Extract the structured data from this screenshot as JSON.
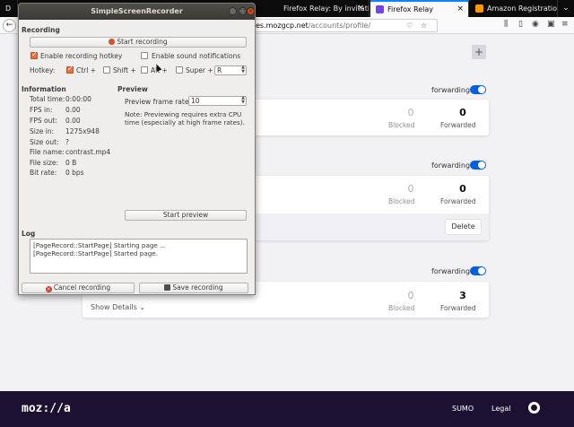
{
  "browser": {
    "tabs": [
      {
        "label": "D",
        "active": false
      },
      {
        "label": "Firefox Relay: By invitati",
        "active": false
      },
      {
        "label": "Firefox Relay",
        "active": true
      },
      {
        "label": "Amazon Registration",
        "active": false
      }
    ],
    "tab_close": "×",
    "back_label": "←",
    "url_host": "es.mozgcp.net",
    "url_path": "/accounts/profile/"
  },
  "relay": {
    "add_label": "+",
    "forwarding_label": "forwarding",
    "cards": [
      {
        "blocked": "0",
        "blocked_label": "Blocked",
        "forwarded": "0",
        "forwarded_label": "Forwarded"
      },
      {
        "blocked": "0",
        "blocked_label": "Blocked",
        "forwarded": "0",
        "forwarded_label": "Forwarded",
        "delete_label": "Delete"
      },
      {
        "blocked": "0",
        "blocked_label": "Blocked",
        "forwarded": "3",
        "forwarded_label": "Forwarded",
        "show_details": "Show Details ⌄"
      }
    ]
  },
  "footer": {
    "logo": "moz://a",
    "links": [
      "SUMO",
      "Legal"
    ]
  },
  "ssr": {
    "title": "SimpleScreenRecorder",
    "recording": {
      "section": "Recording",
      "start_button": "Start recording",
      "enable_hotkey": "Enable recording hotkey",
      "enable_hotkey_checked": true,
      "enable_sound": "Enable sound notifications",
      "enable_sound_checked": false,
      "hotkey_label": "Hotkey:",
      "ctrl": "Ctrl +",
      "ctrl_checked": true,
      "shift": "Shift +",
      "shift_checked": false,
      "alt": "Alt +",
      "alt_checked": false,
      "super": "Super +",
      "super_checked": false,
      "key": "R"
    },
    "information": {
      "section": "Information",
      "rows": [
        {
          "label": "Total time:",
          "value": "0:00:00"
        },
        {
          "label": "FPS in:",
          "value": "0.00"
        },
        {
          "label": "FPS out:",
          "value": "0.00"
        },
        {
          "label": "Size in:",
          "value": "1275x948"
        },
        {
          "label": "Size out:",
          "value": "?"
        },
        {
          "label": "File name:",
          "value": "contrast.mp4"
        },
        {
          "label": "File size:",
          "value": "0 B"
        },
        {
          "label": "Bit rate:",
          "value": "0 bps"
        }
      ]
    },
    "preview": {
      "section": "Preview",
      "frame_rate_label": "Preview frame rate:",
      "frame_rate": "10",
      "note": "Note: Previewing requires extra CPU time (especially at high frame rates).",
      "start_button": "Start preview"
    },
    "log": {
      "section": "Log",
      "lines": [
        "[PageRecord::StartPage] Starting page ...",
        "[PageRecord::StartPage] Started page."
      ]
    },
    "cancel_button": "Cancel recording",
    "save_button": "Save recording"
  }
}
